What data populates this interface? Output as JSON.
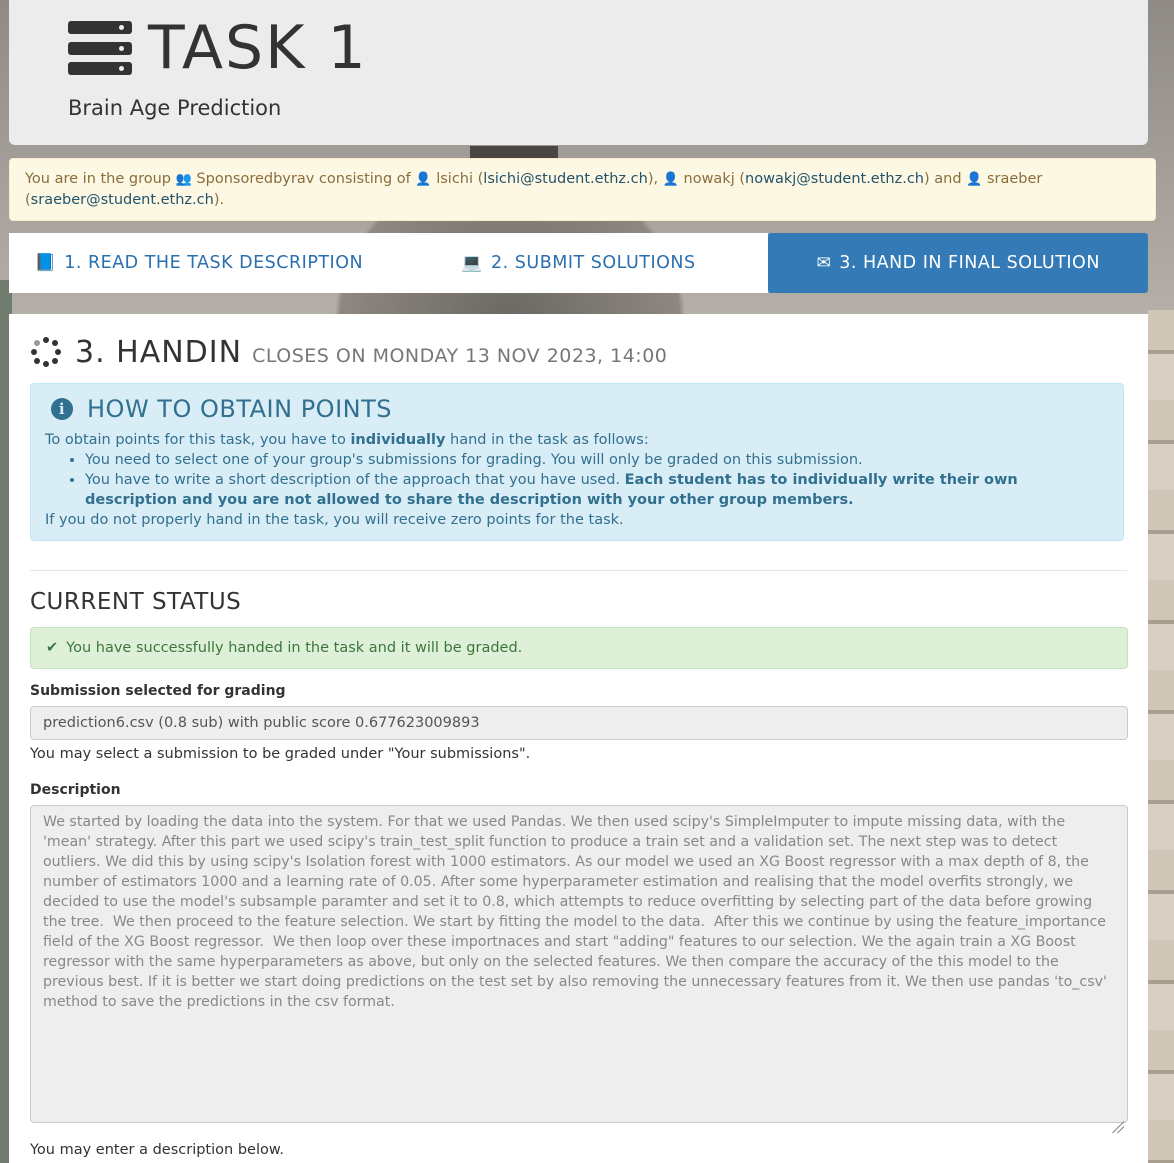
{
  "header": {
    "title": "TASK 1",
    "subtitle": "Brain Age Prediction"
  },
  "group_alert": {
    "prefix": "You are in the group",
    "group_name": "Sponsoredbyrav",
    "consisting_of": "consisting of",
    "members": [
      {
        "name": "lsichi",
        "email": "lsichi@student.ethz.ch"
      },
      {
        "name": "nowakj",
        "email": "nowakj@student.ethz.ch"
      },
      {
        "name": "sraeber",
        "email": "sraeber@student.ethz.ch"
      }
    ],
    "and": "and"
  },
  "tabs": [
    {
      "label": "1. READ THE TASK DESCRIPTION",
      "icon": "book-icon"
    },
    {
      "label": "2. SUBMIT SOLUTIONS",
      "icon": "laptop-icon"
    },
    {
      "label": "3. HAND IN FINAL SOLUTION",
      "icon": "envelope-icon",
      "active": true
    }
  ],
  "handin": {
    "title": "3. HANDIN",
    "closes": "CLOSES ON MONDAY 13 NOV 2023, 14:00"
  },
  "info": {
    "heading": "HOW TO OBTAIN POINTS",
    "intro_pre": "To obtain points for this task, you have to",
    "intro_bold": "individually",
    "intro_post": "hand in the task as follows:",
    "bullet1": "You need to select one of your group's submissions for grading. You will only be graded on this submission.",
    "bullet2_pre": "You have to write a short description of the approach that you have used.",
    "bullet2_bold": "Each student has to individually write their own description and you are not allowed to share the description with your other group members.",
    "footer": "If you do not properly hand in the task, you will receive zero points for the task."
  },
  "status": {
    "heading": "CURRENT STATUS",
    "success": "You have successfully handed in the task and it will be graded.",
    "submission_label": "Submission selected for grading",
    "submission_value": "prediction6.csv (0.8 sub) with public score 0.677623009893",
    "submission_help": "You may select a submission to be graded under \"Your submissions\".",
    "description_label": "Description",
    "description_value": "We started by loading the data into the system. For that we used Pandas. We then used scipy's SimpleImputer to impute missing data, with the 'mean' strategy. After this part we used scipy's train_test_split function to produce a train set and a validation set. The next step was to detect outliers. We did this by using scipy's Isolation forest with 1000 estimators. As our model we used an XG Boost regressor with a max depth of 8, the number of estimators 1000 and a learning rate of 0.05. After some hyperparameter estimation and realising that the model overfits strongly, we decided to use the model's subsample paramter and set it to 0.8, which attempts to reduce overfitting by selecting part of the data before growing the tree.  We then proceed to the feature selection. We start by fitting the model to the data.  After this we continue by using the feature_importance field of the XG Boost regressor.  We then loop over these importnaces and start \"adding\" features to our selection. We the again train a XG Boost regressor with the same hyperparameters as above, but only on the selected features. We then compare the accuracy of the this model to the previous best. If it is better we start doing predictions on the test set by also removing the unnecessary features from it. We then use pandas 'to_csv' method to save the predictions in the csv format.",
    "description_help": "You may enter a description below."
  }
}
